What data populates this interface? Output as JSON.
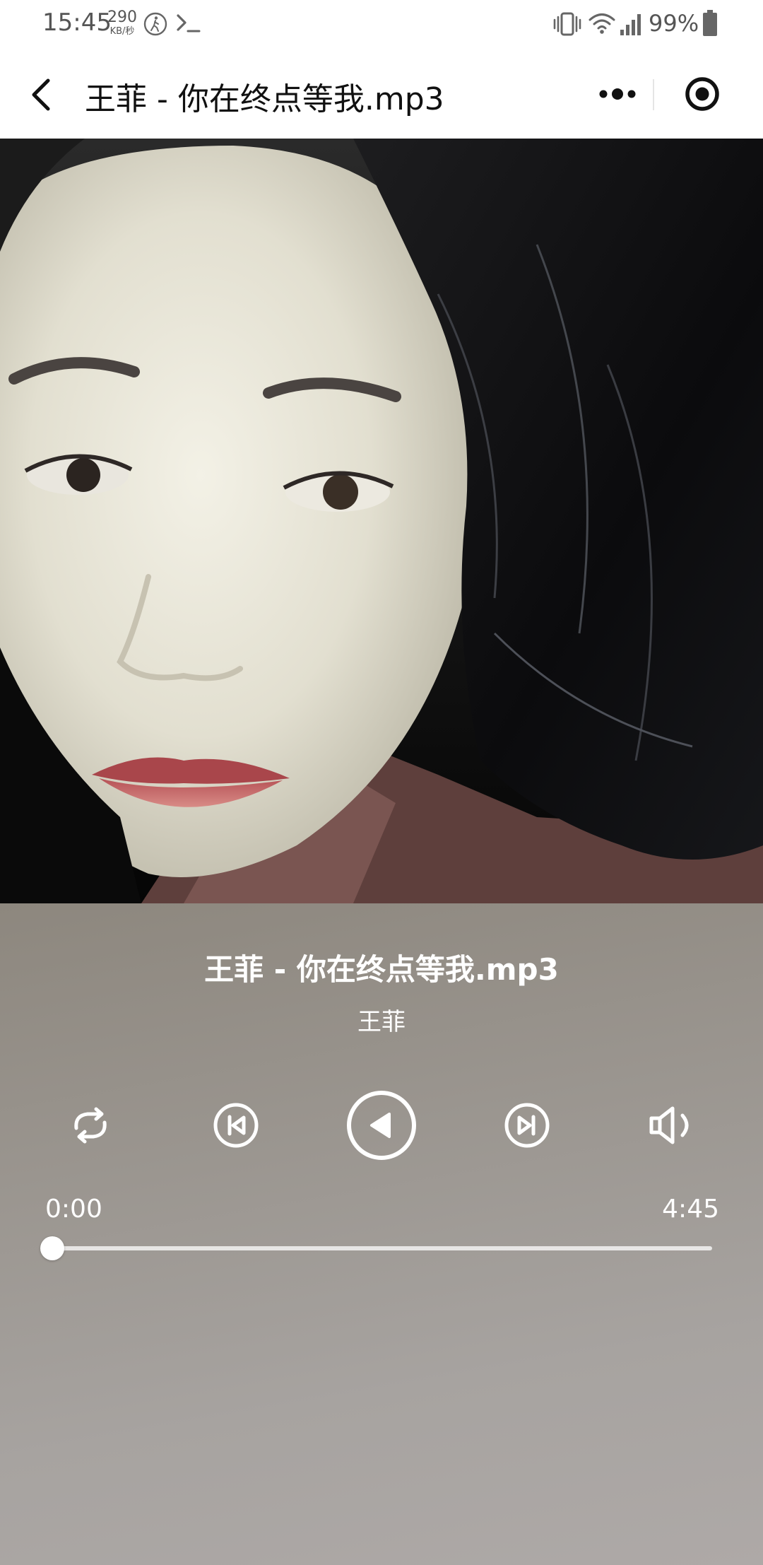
{
  "status_bar": {
    "time": "15:45",
    "net_speed_value": "290",
    "net_speed_unit": "KB/秒",
    "battery_percent": "99%"
  },
  "nav": {
    "title": "王菲 - 你在终点等我.mp3"
  },
  "player": {
    "title": "王菲 - 你在终点等我.mp3",
    "artist": "王菲",
    "current_time": "0:00",
    "total_time": "4:45",
    "progress": 0,
    "controls": [
      "loop-icon",
      "previous-icon",
      "play-icon",
      "next-icon",
      "volume-icon"
    ]
  },
  "colors": {
    "panel": "#9a958f",
    "text": "#ffffff",
    "nav_text": "#111111"
  }
}
